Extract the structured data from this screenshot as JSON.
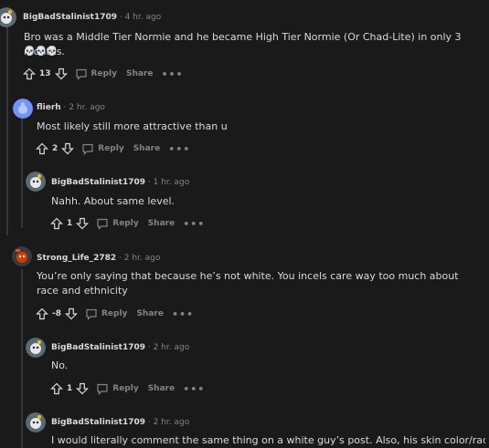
{
  "colors": {
    "background": "#1a1a1b",
    "text": "#d7dadc",
    "muted": "#818384",
    "line": "#343536"
  },
  "comments": [
    {
      "author": "BigBadStalinist1709",
      "time": "4 hr. ago",
      "body": "Bro was a Middle Tier Normie and he became High Tier Normie (Or Chad-Lite) in only 3 months.",
      "emoji": "💀💀💀",
      "score": "13",
      "reply": "Reply",
      "share": "Share",
      "avatar": "snoo-avatar"
    },
    {
      "author": "flierh",
      "time": "2 hr. ago",
      "body": "Most likely still more attractive than u",
      "score": "2",
      "reply": "Reply",
      "share": "Share",
      "avatar": "default-avatar"
    },
    {
      "author": "BigBadStalinist1709",
      "time": "1 hr. ago",
      "body": "Nahh. About same level.",
      "score": "1",
      "reply": "Reply",
      "share": "Share",
      "avatar": "snoo-avatar"
    },
    {
      "author": "Strong_Life_2782",
      "time": "2 hr. ago",
      "body": "You’re only saying that because he’s not white. You incels care way too much about race and ethnicity",
      "score": "-8",
      "reply": "Reply",
      "share": "Share",
      "avatar": "snoo-red-avatar"
    },
    {
      "author": "BigBadStalinist1709",
      "time": "2 hr. ago",
      "body": "No.",
      "score": "1",
      "reply": "Reply",
      "share": "Share",
      "avatar": "snoo-avatar"
    },
    {
      "author": "BigBadStalinist1709",
      "time": "2 hr. ago",
      "body": "I would literally comment the same thing on a white guy’s post. Also, his skin color/race",
      "avatar": "snoo-avatar"
    }
  ],
  "separator": " · "
}
